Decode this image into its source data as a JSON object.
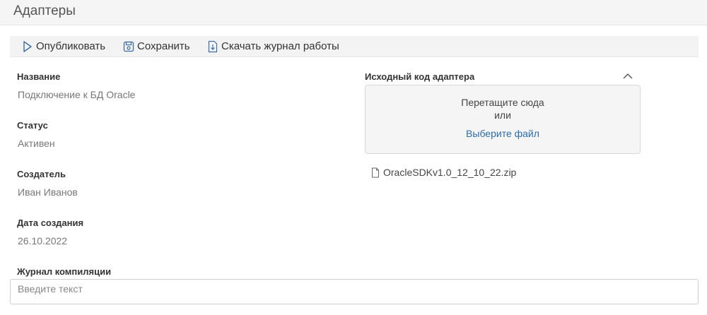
{
  "page": {
    "title": "Адаптеры"
  },
  "toolbar": {
    "publish_label": "Опубликовать",
    "save_label": "Сохранить",
    "download_log_label": "Скачать журнал работы"
  },
  "fields": {
    "name": {
      "label": "Название",
      "value": "Подключение к БД Oracle"
    },
    "status": {
      "label": "Статус",
      "value": "Активен"
    },
    "creator": {
      "label": "Создатель",
      "value": "Иван Иванов"
    },
    "created": {
      "label": "Дата создания",
      "value": "26.10.2022"
    },
    "compile_log": {
      "label": "Журнал компиляции",
      "placeholder": "Введите текст"
    }
  },
  "source_code": {
    "label": "Исходный код адаптера",
    "drop_text_1": "Перетащите сюда",
    "drop_text_2": "или",
    "choose_file": "Выберите файл",
    "file_name": "OracleSDKv1.0_12_10_22.zip"
  },
  "colors": {
    "accent_link": "#2b6cb0",
    "toolbar_bg": "#f3f3f3"
  }
}
